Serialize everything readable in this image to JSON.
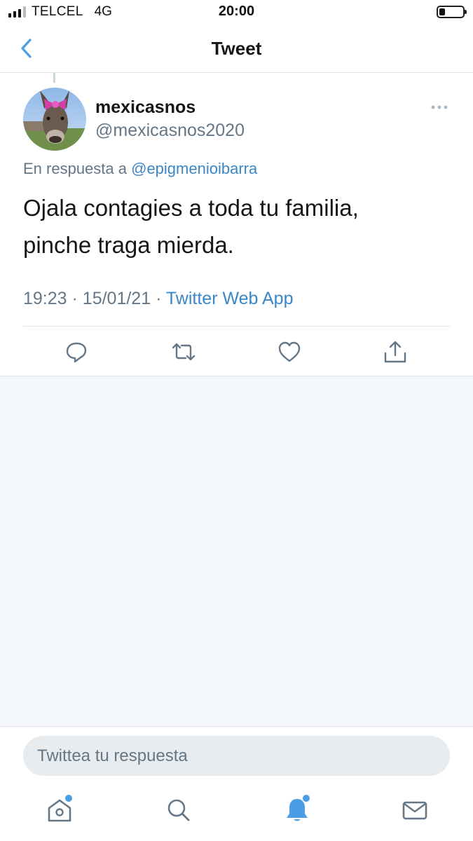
{
  "status_bar": {
    "carrier": "TELCEL",
    "network": "4G",
    "time": "20:00"
  },
  "header": {
    "title": "Tweet",
    "back_icon": "chevron-left-icon"
  },
  "tweet": {
    "display_name": "mexicasnos",
    "handle": "@mexicasnos2020",
    "reply_prefix": "En respuesta a",
    "reply_to": "@epigmenioibarra",
    "text_line1": "Ojala contagies a toda tu familia,",
    "text_line2": "pinche traga mierda.",
    "time": "19:23",
    "date": "15/01/21",
    "separator": "·",
    "source": "Twitter Web App"
  },
  "actions": [
    "reply-icon",
    "retweet-icon",
    "like-icon",
    "share-icon"
  ],
  "composer": {
    "placeholder": "Twittea tu respuesta"
  },
  "tabbar": [
    "home-icon",
    "search-icon",
    "notifications-icon",
    "messages-icon"
  ],
  "colors": {
    "accent": "#4a9ee6",
    "link": "#3a87c8",
    "secondary_text": "#657786",
    "background_empty": "#f5f8fa"
  }
}
